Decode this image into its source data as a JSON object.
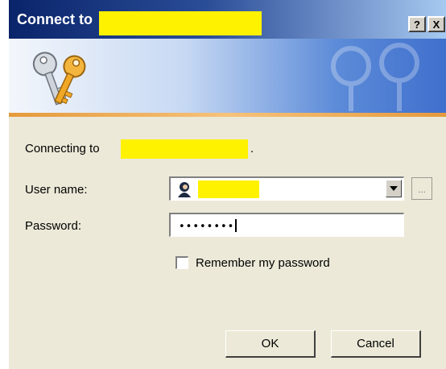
{
  "window": {
    "title": "Connect to",
    "help_label": "?",
    "close_label": "X"
  },
  "form": {
    "connecting_label": "Connecting to",
    "connecting_suffix": ".",
    "username_label": "User name:",
    "username_value": "",
    "password_label": "Password:",
    "password_value": "••••••••",
    "browse_label": "...",
    "remember_label": "Remember my password",
    "remember_checked": false
  },
  "buttons": {
    "ok_label": "OK",
    "cancel_label": "Cancel"
  },
  "icons": [
    "keys-icon",
    "user-icon",
    "chevron-down-icon"
  ],
  "colors": {
    "titlebar_start": "#0a246a",
    "dialog_bg": "#ece9d8",
    "redaction": "#fff200",
    "banner_accent": "#e59a3b"
  }
}
